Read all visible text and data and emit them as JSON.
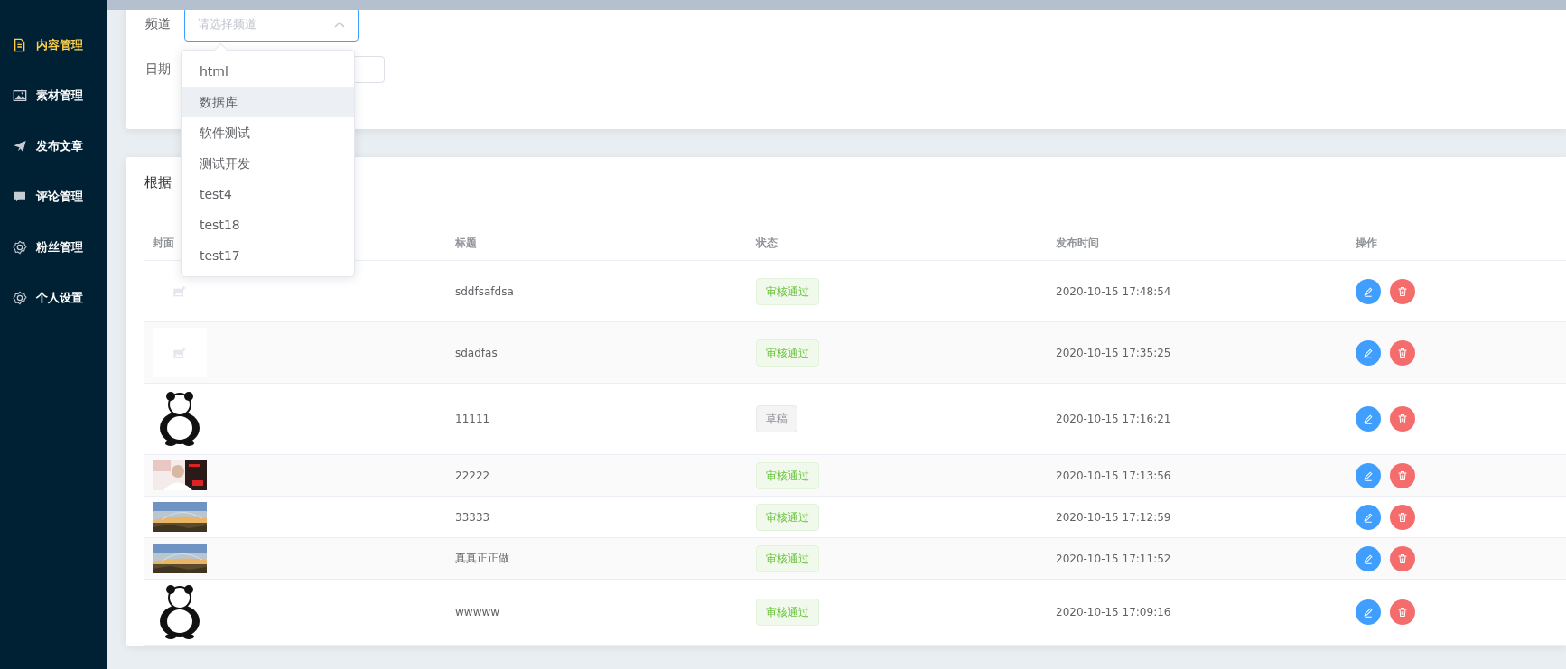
{
  "sidebar": {
    "items": [
      {
        "label": "内容管理",
        "selected": true
      },
      {
        "label": "素材管理",
        "selected": false
      },
      {
        "label": "发布文章",
        "selected": false
      },
      {
        "label": "评论管理",
        "selected": false
      },
      {
        "label": "粉丝管理",
        "selected": false
      },
      {
        "label": "个人设置",
        "selected": false
      }
    ]
  },
  "filter_form": {
    "channel": {
      "label": "频道",
      "placeholder": "请选择频道"
    },
    "date": {
      "label": "日期"
    }
  },
  "channel_dropdown": {
    "options": [
      {
        "label": "html",
        "highlighted": false
      },
      {
        "label": "数据库",
        "highlighted": true
      },
      {
        "label": "软件测试",
        "highlighted": false
      },
      {
        "label": "测试开发",
        "highlighted": false
      },
      {
        "label": "test4",
        "highlighted": false
      },
      {
        "label": "test18",
        "highlighted": false
      },
      {
        "label": "test17",
        "highlighted": false
      }
    ]
  },
  "results": {
    "title": "根据",
    "table": {
      "columns": [
        "封面",
        "标题",
        "状态",
        "发布时间",
        "操作"
      ],
      "rows": [
        {
          "cover": {
            "kind": "placeholder"
          },
          "title": "sddfsafdsa",
          "status": {
            "text": "审核通过",
            "kind": "approved"
          },
          "time": "2020-10-15 17:48:54"
        },
        {
          "cover": {
            "kind": "placeholder"
          },
          "title": "sdadfas",
          "status": {
            "text": "审核通过",
            "kind": "approved"
          },
          "time": "2020-10-15 17:35:25"
        },
        {
          "title": "11111",
          "status": {
            "text": "草稿",
            "kind": "draft"
          },
          "time": "2020-10-15 17:16:21"
        },
        {
          "title": "22222",
          "status": {
            "text": "审核通过",
            "kind": "approved"
          },
          "time": "2020-10-15 17:13:56"
        },
        {
          "title": "33333",
          "status": {
            "text": "审核通过",
            "kind": "approved"
          },
          "time": "2020-10-15 17:12:59"
        },
        {
          "title": "真真正正做",
          "status": {
            "text": "审核通过",
            "kind": "approved"
          },
          "time": "2020-10-15 17:11:52"
        },
        {
          "title": "wwwww",
          "status": {
            "text": "审核通过",
            "kind": "approved"
          },
          "time": "2020-10-15 17:09:16"
        }
      ]
    }
  }
}
